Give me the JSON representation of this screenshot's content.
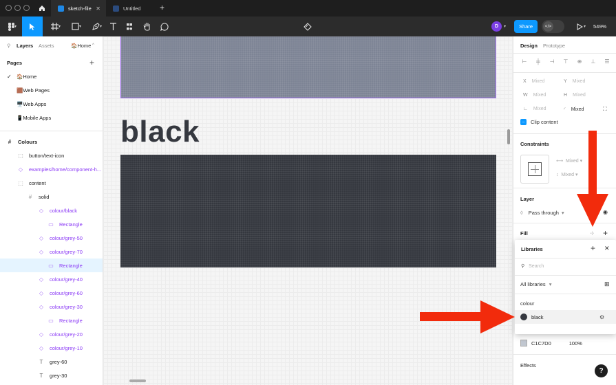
{
  "titlebar": {
    "tabs": [
      {
        "label": "sketch-file",
        "active": true
      },
      {
        "label": "Untitled",
        "active": false
      }
    ]
  },
  "toolbar": {
    "share_label": "Share",
    "avatar_initial": "D",
    "zoom": "549%"
  },
  "left_panel": {
    "tabs": {
      "layers": "Layers",
      "assets": "Assets",
      "page_selector": "🏠Home"
    },
    "pages_title": "Pages",
    "pages": [
      {
        "label": "🏠Home",
        "current": true
      },
      {
        "label": "🟫Web Pages"
      },
      {
        "label": "🖥️Web Apps"
      },
      {
        "label": "📱Mobile Apps"
      }
    ],
    "layers": [
      {
        "label": "Colours",
        "icon": "frame-icon",
        "indent": 0,
        "bold": true
      },
      {
        "label": "button/text-icon",
        "icon": "frame-dashed-icon",
        "indent": 1
      },
      {
        "label": "examples/home/component-h...",
        "icon": "instance-icon",
        "indent": 1,
        "purple": true
      },
      {
        "label": "content",
        "icon": "frame-dashed-icon",
        "indent": 1
      },
      {
        "label": "solid",
        "icon": "frame-icon",
        "indent": 2
      },
      {
        "label": "colour/black",
        "icon": "instance-icon",
        "indent": 3,
        "purple": true
      },
      {
        "label": "Rectangle",
        "icon": "rectangle-icon",
        "indent": 4,
        "purple": true
      },
      {
        "label": "colour/grey-50",
        "icon": "instance-icon",
        "indent": 3,
        "purple": true
      },
      {
        "label": "colour/grey-70",
        "icon": "instance-icon",
        "indent": 3,
        "purple": true
      },
      {
        "label": "Rectangle",
        "icon": "rectangle-icon",
        "indent": 4,
        "purple": true,
        "selected": true
      },
      {
        "label": "colour/grey-40",
        "icon": "instance-icon",
        "indent": 3,
        "purple": true
      },
      {
        "label": "colour/grey-60",
        "icon": "instance-icon",
        "indent": 3,
        "purple": true
      },
      {
        "label": "colour/grey-30",
        "icon": "instance-icon",
        "indent": 3,
        "purple": true
      },
      {
        "label": "Rectangle",
        "icon": "rectangle-icon",
        "indent": 4,
        "purple": true
      },
      {
        "label": "colour/grey-20",
        "icon": "instance-icon",
        "indent": 3,
        "purple": true
      },
      {
        "label": "colour/grey-10",
        "icon": "instance-icon",
        "indent": 3,
        "purple": true
      },
      {
        "label": "grey-60",
        "icon": "text-icon",
        "indent": 3
      },
      {
        "label": "grey-30",
        "icon": "text-icon",
        "indent": 3
      }
    ]
  },
  "canvas": {
    "heading": "black",
    "colors": {
      "top_swatch": "#7d8495",
      "black_swatch": "#35383f",
      "selection": "#a26cf5"
    }
  },
  "right_panel": {
    "tabs": {
      "design": "Design",
      "prototype": "Prototype"
    },
    "props": {
      "x_label": "X",
      "x_value": "Mixed",
      "y_label": "Y",
      "y_value": "Mixed",
      "w_label": "W",
      "w_value": "Mixed",
      "h_label": "H",
      "h_value": "Mixed",
      "rotation_value": "Mixed",
      "radius_value": "Mixed"
    },
    "clip_content": "Clip content",
    "constraints_title": "Constraints",
    "constraint_h": "Mixed",
    "constraint_v": "Mixed",
    "layer_title": "Layer",
    "blend_mode": "Pass through",
    "fill_title": "Fill",
    "fill_hex": "C1C7D0",
    "fill_opacity": "100%",
    "effects_title": "Effects"
  },
  "libraries_popover": {
    "title": "Libraries",
    "search_placeholder": "Search",
    "filter": "All libraries",
    "group": "colour",
    "items": [
      {
        "label": "black",
        "color": "#35383f"
      }
    ]
  },
  "help_label": "?",
  "annotation_color": "#f22b0c"
}
